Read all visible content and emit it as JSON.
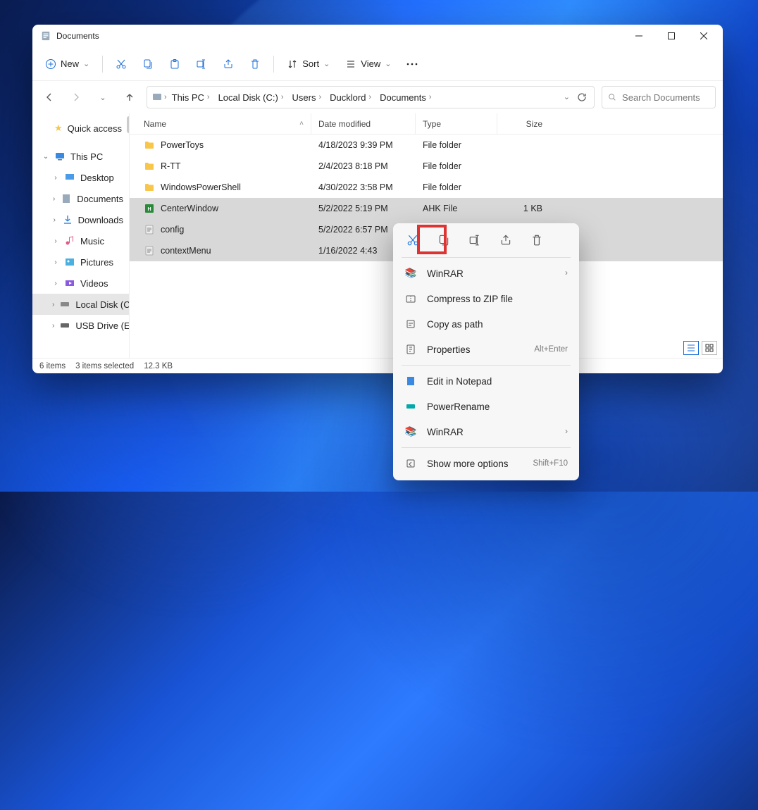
{
  "window": {
    "title": "Documents"
  },
  "toolbar": {
    "new_label": "New",
    "sort_label": "Sort",
    "view_label": "View"
  },
  "breadcrumbs": [
    "This PC",
    "Local Disk (C:)",
    "Users",
    "Ducklord",
    "Documents"
  ],
  "search": {
    "placeholder": "Search Documents"
  },
  "sidebar": {
    "quick_access": "Quick access",
    "this_pc": "This PC",
    "items": [
      "Desktop",
      "Documents",
      "Downloads",
      "Music",
      "Pictures",
      "Videos",
      "Local Disk (C:)",
      "USB Drive (E:)"
    ]
  },
  "columns": {
    "name": "Name",
    "date": "Date modified",
    "type": "Type",
    "size": "Size"
  },
  "files": [
    {
      "name": "PowerToys",
      "date": "4/18/2023 9:39 PM",
      "type": "File folder",
      "size": "",
      "icon": "folder",
      "selected": false
    },
    {
      "name": "R-TT",
      "date": "2/4/2023 8:18 PM",
      "type": "File folder",
      "size": "",
      "icon": "folder",
      "selected": false
    },
    {
      "name": "WindowsPowerShell",
      "date": "4/30/2022 3:58 PM",
      "type": "File folder",
      "size": "",
      "icon": "folder",
      "selected": false
    },
    {
      "name": "CenterWindow",
      "date": "5/2/2022 5:19 PM",
      "type": "AHK File",
      "size": "1 KB",
      "icon": "ahk",
      "selected": true
    },
    {
      "name": "config",
      "date": "5/2/2022 6:57 PM",
      "type": "",
      "size": "",
      "icon": "doc",
      "selected": true
    },
    {
      "name": "contextMenu",
      "date": "1/16/2022 4:43",
      "type": "",
      "size": "",
      "icon": "doc",
      "selected": true
    }
  ],
  "status": {
    "items": "6 items",
    "selected": "3 items selected",
    "size": "12.3 KB"
  },
  "context_menu": {
    "winrar_sub": "WinRAR",
    "compress": "Compress to ZIP file",
    "copy_path": "Copy as path",
    "properties": "Properties",
    "properties_hint": "Alt+Enter",
    "edit_notepad": "Edit in Notepad",
    "powerrename": "PowerRename",
    "winrar": "WinRAR",
    "show_more": "Show more options",
    "show_more_hint": "Shift+F10"
  }
}
